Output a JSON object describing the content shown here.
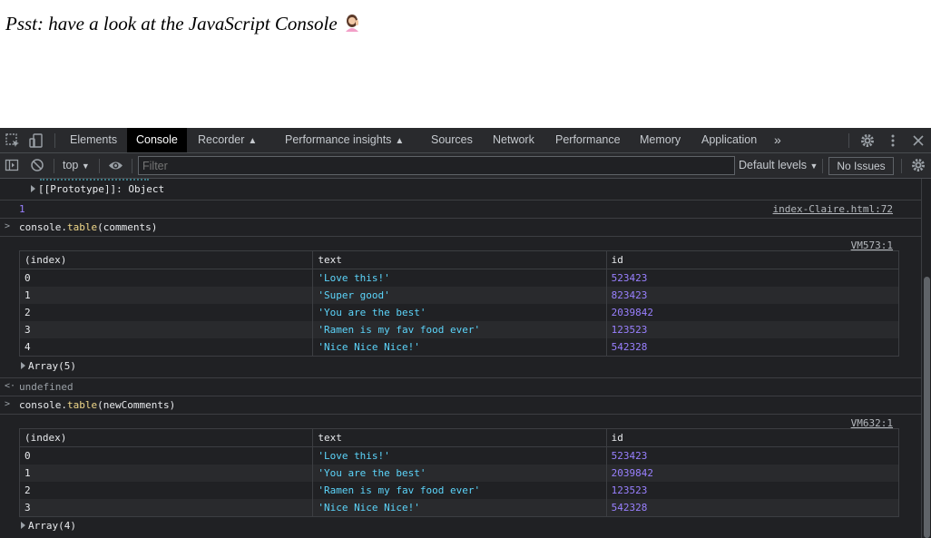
{
  "page": {
    "message": "Psst: have a look at the JavaScript Console"
  },
  "devtools": {
    "tabs": [
      {
        "label": "Elements"
      },
      {
        "label": "Console"
      },
      {
        "label": "Recorder"
      },
      {
        "label": "Performance insights"
      },
      {
        "label": "Sources"
      },
      {
        "label": "Network"
      },
      {
        "label": "Performance"
      },
      {
        "label": "Memory"
      },
      {
        "label": "Application"
      }
    ],
    "more_tabs": "»",
    "toolbar": {
      "context": "top",
      "filter_placeholder": "Filter",
      "levels": "Default levels",
      "issues": "No Issues"
    },
    "console": {
      "prototype_line": "[[Prototype]]: Object",
      "log_value": "1",
      "log_source": "index-Claire.html:72",
      "commands": [
        {
          "prefix": "console.",
          "method": "table",
          "arg": "(comments)",
          "source": "VM573:1",
          "headers": [
            "(index)",
            "text",
            "id"
          ],
          "rows": [
            [
              "0",
              "'Love this!'",
              "523423"
            ],
            [
              "1",
              "'Super good'",
              "823423"
            ],
            [
              "2",
              "'You are the best'",
              "2039842"
            ],
            [
              "3",
              "'Ramen is my fav food ever'",
              "123523"
            ],
            [
              "4",
              "'Nice Nice Nice!'",
              "542328"
            ]
          ],
          "summary": "Array(5)"
        },
        {
          "prefix": "console.",
          "method": "table",
          "arg": "(newComments)",
          "source": "VM632:1",
          "headers": [
            "(index)",
            "text",
            "id"
          ],
          "rows": [
            [
              "0",
              "'Love this!'",
              "523423"
            ],
            [
              "1",
              "'You are the best'",
              "2039842"
            ],
            [
              "2",
              "'Ramen is my fav food ever'",
              "123523"
            ],
            [
              "3",
              "'Nice Nice Nice!'",
              "542328"
            ]
          ],
          "summary": "Array(4)"
        }
      ],
      "return_value": "undefined"
    },
    "colors": {
      "background": "#202124",
      "string": "#5cd5fb",
      "number": "#9980ff",
      "method": "#f0d88a"
    }
  }
}
